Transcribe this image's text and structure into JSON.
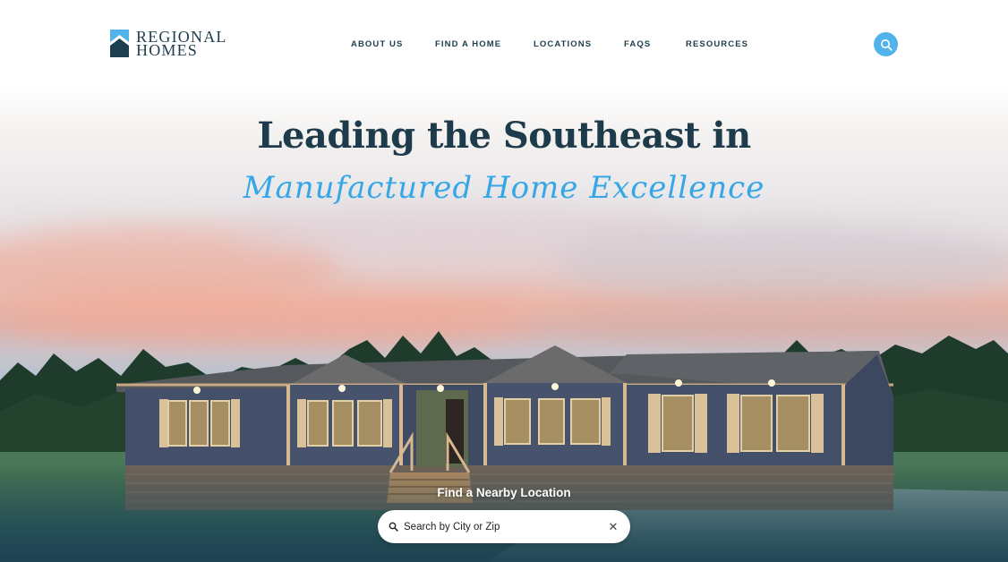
{
  "brand": {
    "line1": "REGIONAL",
    "line2": "HOMES",
    "color": "#1d3e4e",
    "accent": "#52b3ea"
  },
  "nav": {
    "items": [
      {
        "label": "ABOUT US"
      },
      {
        "label": "FIND A HOME"
      },
      {
        "label": "LOCATIONS"
      },
      {
        "label": "FAQS"
      },
      {
        "label": "RESOURCES"
      }
    ],
    "search_icon": "search-icon"
  },
  "hero": {
    "headline": "Leading the Southeast in",
    "script": "Manufactured Home Excellence",
    "image": "manufactured-home-at-dusk"
  },
  "location_search": {
    "label": "Find a Nearby Location",
    "placeholder": "Search by City or Zip",
    "value": "",
    "search_icon": "magnifier-icon",
    "clear_icon": "close-icon"
  },
  "colors": {
    "headline": "#1e3b4c",
    "script": "#35a6e6"
  }
}
